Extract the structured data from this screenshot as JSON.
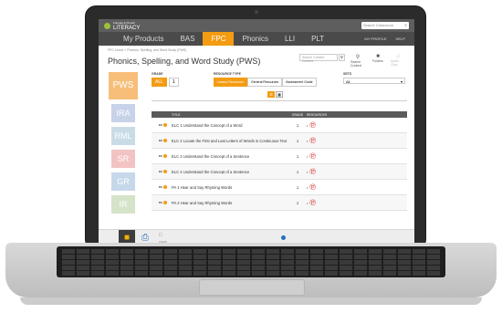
{
  "app": {
    "logo_line1": "Fountas & Pinnell",
    "logo_line2": "LITERACY",
    "search_placeholder": "Search Classroom",
    "search_icon": "search-icon"
  },
  "nav": {
    "items": [
      {
        "label": "My Products",
        "active": false
      },
      {
        "label": "BAS",
        "active": false
      },
      {
        "label": "FPC",
        "active": true
      },
      {
        "label": "Phonics",
        "active": false
      },
      {
        "label": "LLI",
        "active": false
      },
      {
        "label": "PLT",
        "active": false
      }
    ],
    "profile": "MY PROFILE",
    "help": "HELP"
  },
  "breadcrumb": "FPC Home > Phonics, Spelling, and Word Study (PWS)",
  "page": {
    "title": "Phonics, Spelling, and Word Study (PWS)",
    "search_content_placeholder": "Search Content Context",
    "tools": [
      {
        "label": "Search Context",
        "icon": "search-icon",
        "enabled": true
      },
      {
        "label": "Folders",
        "icon": "folder-icon",
        "enabled": true
      },
      {
        "label": "Audio Clips",
        "icon": "audio-icon",
        "enabled": false
      }
    ]
  },
  "sidebar": {
    "items": [
      {
        "label": "PWS",
        "color": "#f7be7a"
      },
      {
        "label": "IRA",
        "color": "#c7d3e8"
      },
      {
        "label": "RML",
        "color": "#c9dbe7"
      },
      {
        "label": "SR",
        "color": "#f3c3c3"
      },
      {
        "label": "GR",
        "color": "#c6d8ea"
      },
      {
        "label": "IR",
        "color": "#d5e3c9"
      }
    ]
  },
  "filters": {
    "grade_label": "GRADE",
    "grade_options": [
      {
        "label": "ALL",
        "selected": true
      },
      {
        "label": "1",
        "selected": false
      }
    ],
    "resource_type_label": "RESOURCE TYPE",
    "resource_types": [
      {
        "label": "Lesson Resources",
        "selected": true
      },
      {
        "label": "General Resources",
        "selected": false
      },
      {
        "label": "Assessment Guide",
        "selected": false
      }
    ],
    "sets_label": "SETS",
    "sets_value": "All",
    "view_modes": [
      "list-view-icon",
      "grid-view-icon"
    ]
  },
  "table": {
    "columns": [
      "TITLE",
      "GRADE",
      "RESOURCES"
    ],
    "rows": [
      {
        "code": "EC",
        "title": "ELC 1 Understand the Concept of a Word",
        "grade": "1"
      },
      {
        "code": "EC",
        "title": "ELC 2 Locate the First and Last Letters of Words in Continuous Text",
        "grade": "1"
      },
      {
        "code": "EC",
        "title": "ELC 3 Understand the Concept of a Sentence",
        "grade": "1"
      },
      {
        "code": "EC",
        "title": "ELC 4 Understand the Concept of a Sentence",
        "grade": "1"
      },
      {
        "code": "PA",
        "title": "PA 1 Hear and Say Rhyming Words",
        "grade": "1"
      },
      {
        "code": "PA",
        "title": "PA 2 Hear and Say Rhyming Words",
        "grade": "1"
      }
    ]
  },
  "bottom": {
    "folder_icon": "folder-icon",
    "print_icon": "print-icon",
    "label": "ITEMS"
  },
  "colors": {
    "accent": "#f39c12",
    "nav_bg": "#4a4a4a",
    "topbar_bg": "#5e5e5e",
    "pdf_red": "#d12b2b"
  }
}
